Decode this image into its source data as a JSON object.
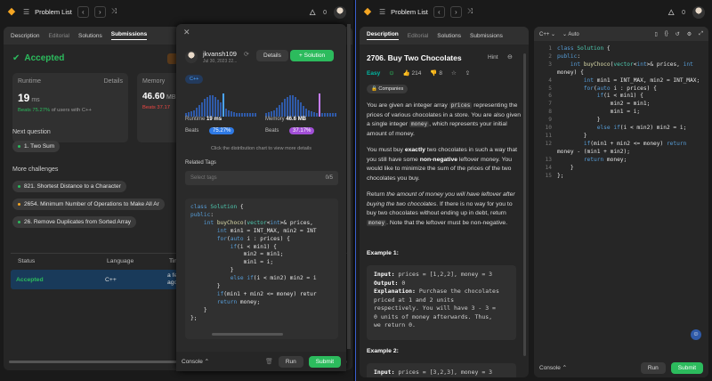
{
  "left": {
    "topbar": {
      "title": "Problem List"
    },
    "tabs": [
      "Description",
      "Editorial",
      "Solutions",
      "Submissions"
    ],
    "status": "Accepted",
    "runtime": {
      "label": "Runtime",
      "details": "Details",
      "value": "19",
      "unit": "ms",
      "beats_pct": "Beats 75.27%",
      "beats_rest": "of users with C++"
    },
    "memory": {
      "label": "Memory",
      "value": "46.60",
      "unit": "MB",
      "beats_pct": "Beats 37.17"
    },
    "next_question": {
      "label": "Next question",
      "item": "1. Two Sum"
    },
    "more_challenges": {
      "label": "More challenges",
      "items": [
        "821. Shortest Distance to a Character",
        "2654. Minimum Number of Operations to Make All Ar",
        "26. Remove Duplicates from Sorted Array"
      ]
    },
    "table": {
      "headers": [
        "Status",
        "Language",
        "Tim"
      ],
      "row": {
        "status": "Accepted",
        "language": "C++",
        "time": "a fe",
        "time2": "ago"
      }
    }
  },
  "popup": {
    "user": "jkvansh109",
    "date": "Jul 30, 2023 22...",
    "details_btn": "Details",
    "solution_btn": "Solution",
    "lang": "C++",
    "runtime_label": "Runtime",
    "runtime_value": "19 ms",
    "memory_label": "Memory",
    "memory_value": "46.6 MB",
    "beats_label": "Beats",
    "runtime_beats": "75.27%",
    "memory_beats": "37.17%",
    "hint": "Click the distribution chart to view more details",
    "related_tags": "Related Tags",
    "select_tags": "Select tags",
    "tag_count": "0/5",
    "code": [
      "class Solution {",
      "public:",
      "    int buyChoco(vector<int>& prices,",
      "        int min1 = INT_MAX, min2 = INT",
      "        for(auto i : prices) {",
      "            if(i < min1) {",
      "                min2 = min1;",
      "                min1 = i;",
      "            }",
      "            else if(i < min2) min2 = i",
      "        }",
      "        if(min1 + min2 <= money) retur",
      "        return money;",
      "    }",
      "};"
    ],
    "console": "Console",
    "run": "Run",
    "submit": "Submit"
  },
  "right": {
    "topbar": {
      "title": "Problem List"
    },
    "tabs": [
      "Description",
      "Editorial",
      "Solutions",
      "Submissions"
    ],
    "problem_title": "2706. Buy Two Chocolates",
    "hint": "Hint",
    "difficulty": "Easy",
    "likes": "214",
    "dislikes": "8",
    "companies": "Companies",
    "para1": [
      "You are given an integer array ",
      "prices",
      " representing the prices of various chocolates in a store. You are also given a single integer ",
      "money",
      ", which represents your initial amount of money."
    ],
    "para2": [
      "You must buy ",
      "exactly",
      " two chocolates in such a way that you still have some ",
      "non-negative",
      " leftover money. You would like to minimize the sum of the prices of the two chocolates you buy."
    ],
    "para3": [
      "Return ",
      "the amount of money you will have leftover after buying the two chocolates",
      ". If there is no way for you to buy two chocolates without ending up in debt, return ",
      "money",
      ". Note that the leftover must be non-negative."
    ],
    "example1": {
      "title": "Example 1:",
      "input_label": "Input:",
      "input": " prices = [1,2,2], money = 3",
      "output_label": "Output:",
      "output": " 0",
      "expl_label": "Explanation:",
      "expl": " Purchase the chocolates\npriced at 1 and 2 units\nrespectively. You will have 3 - 3 =\n0 units of money afterwards. Thus,\nwe return 0."
    },
    "example2": {
      "title": "Example 2:",
      "input_label": "Input:",
      "input": " prices = [3,2,3], money = 3"
    },
    "editor_lang": "C++",
    "auto": "Auto",
    "code": [
      "class Solution {",
      "public:",
      "    int buyChoco(vector<int>& prices, int",
      "money) {",
      "        int min1 = INT_MAX, min2 = INT_MAX;",
      "        for(auto i : prices) {",
      "            if(i < min1) {",
      "                min2 = min1;",
      "                min1 = i;",
      "            }",
      "            else if(i < min2) min2 = i;",
      "        }",
      "        if(min1 + min2 <= money) return",
      "money - (min1 + min2);",
      "        return money;",
      "    }",
      "};"
    ],
    "line_numbers": [
      "1",
      "2",
      "3",
      "",
      "4",
      "5",
      "6",
      "7",
      "8",
      "9",
      "10",
      "11",
      "12",
      "",
      "13",
      "14",
      "15"
    ],
    "console": "Console",
    "run": "Run",
    "submit": "Submit"
  }
}
